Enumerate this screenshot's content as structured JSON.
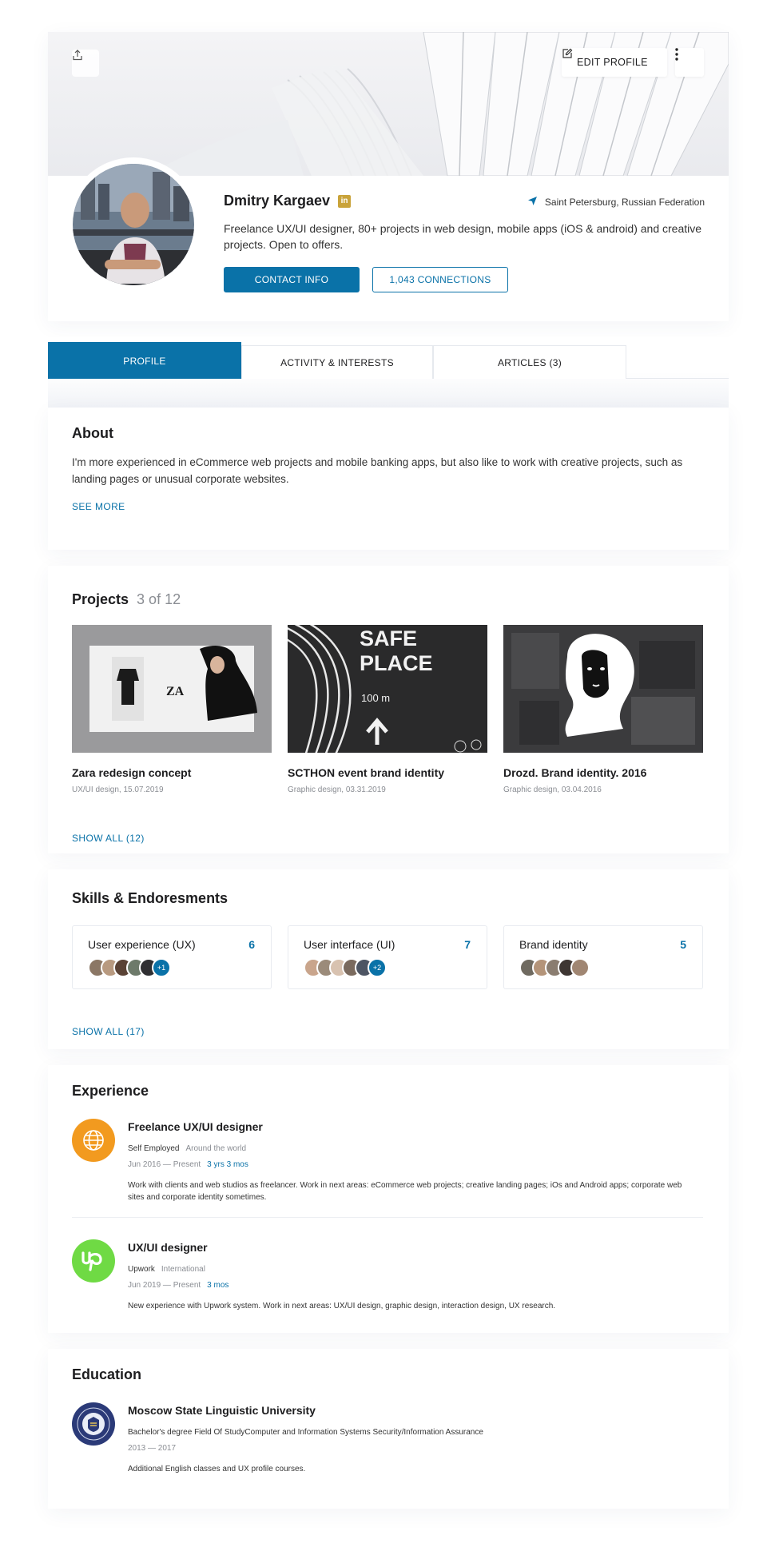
{
  "header": {
    "edit_label": "EDIT PROFILE",
    "name": "Dmitry Kargaev",
    "linkedin_badge": "in",
    "location": "Saint Petersburg, Russian Federation",
    "headline": "Freelance UX/UI designer, 80+ projects in web design, mobile apps  (iOS & android) and creative projects. Open to offers.",
    "contact_label": "CONTACT INFO",
    "connections_label": "1,043 CONNECTIONS"
  },
  "tabs": [
    {
      "label": "PROFILE",
      "active": true
    },
    {
      "label": "ACTIVITY & INTERESTS",
      "active": false
    },
    {
      "label": "ARTICLES (3)",
      "active": false
    }
  ],
  "about": {
    "title": "About",
    "text": "I'm more experienced in eCommerce web projects and mobile banking apps, but also like to work with creative projects, such as landing pages or unusual corporate websites.",
    "see_more": "SEE MORE"
  },
  "projects": {
    "title": "Projects",
    "count": "3 of 12",
    "items": [
      {
        "title": "Zara redesign concept",
        "meta": "UX/UI design, 15.07.2019",
        "thumb_text": "ZA"
      },
      {
        "title": "SCTHON event brand identity",
        "meta": "Graphic design, 03.31.2019",
        "thumb_text_1": "SAFE",
        "thumb_text_2": "PLACE",
        "thumb_text_3": "100 m"
      },
      {
        "title": "Drozd. Brand identity. 2016",
        "meta": "Graphic design, 03.04.2016"
      }
    ],
    "show_all": "SHOW ALL (12)"
  },
  "skills": {
    "title": "Skills & Endoresments",
    "items": [
      {
        "name": "User experience (UX)",
        "count": "6",
        "more": "+1"
      },
      {
        "name": "User interface (UI)",
        "count": "7",
        "more": "+2"
      },
      {
        "name": "Brand identity",
        "count": "5",
        "more": ""
      }
    ],
    "show_all": "SHOW ALL (17)"
  },
  "experience": {
    "title": "Experience",
    "items": [
      {
        "title": "Freelance UX/UI designer",
        "company": "Self Employed",
        "place": "Around the world",
        "dates": "Jun 2016 — Present",
        "duration": "3 yrs 3 mos",
        "description": "Work with clients and web studios as freelancer.  Work in next areas: eCommerce web projects; creative landing pages; iOs and Android apps; corporate web sites and corporate identity sometimes."
      },
      {
        "title": "UX/UI designer",
        "company": "Upwork",
        "place": "International",
        "dates": "Jun 2019 — Present",
        "duration": "3 mos",
        "description": "New experience with Upwork system. Work in next areas: UX/UI design, graphic design, interaction design, UX research."
      }
    ]
  },
  "education": {
    "title": "Education",
    "school": "Moscow State Linguistic University",
    "degree": "Bachelor's degree Field Of StudyComputer and Information Systems Security/Information Assurance",
    "years": "2013 — 2017",
    "note": "Additional English classes and UX profile courses."
  },
  "colors": {
    "accent": "#0a72a8",
    "badge": "#c9a33a",
    "freelance_logo": "#f29a1f",
    "upwork_logo": "#6fda44",
    "university_logo": "#2b3a78"
  }
}
